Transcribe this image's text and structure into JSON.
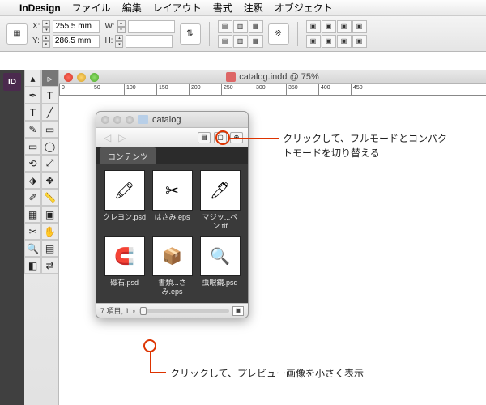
{
  "menubar": {
    "app": "InDesign",
    "items": [
      "ファイル",
      "編集",
      "レイアウト",
      "書式",
      "注釈",
      "オブジェクト"
    ]
  },
  "ctrlbar": {
    "x_label": "X:",
    "y_label": "Y:",
    "w_label": "W:",
    "h_label": "H:",
    "x_value": "255.5 mm",
    "y_value": "286.5 mm"
  },
  "document": {
    "title": "catalog.indd @ 75%"
  },
  "ruler": {
    "marks": [
      "0",
      "50",
      "100",
      "150",
      "200",
      "250",
      "300",
      "350",
      "400"
    ]
  },
  "panel": {
    "title": "catalog",
    "tab": "コンテンツ",
    "footer": "7 項目, 1",
    "items": [
      {
        "label": "クレヨン.psd",
        "icon": "✏️"
      },
      {
        "label": "はさみ.eps",
        "icon": "✂"
      },
      {
        "label": "マジッ...ペン.tif",
        "icon": "🖊"
      },
      {
        "label": "磁石.psd",
        "icon": "🧲"
      },
      {
        "label": "書類...さみ.eps",
        "icon": "📦"
      },
      {
        "label": "虫眼鏡.psd",
        "icon": "🔍"
      }
    ]
  },
  "callouts": {
    "mode": "クリックして、フルモードとコンパクトモードを切り替える",
    "zoom": "クリックして、プレビュー画像を小さく表示"
  },
  "tools": [
    "▲",
    "↔",
    "⬚",
    "⬚",
    "T",
    "／",
    "✒",
    "✎",
    "▭",
    "◯",
    "✂",
    "⊘",
    "➚",
    "⬗",
    "🔍",
    "↔"
  ]
}
